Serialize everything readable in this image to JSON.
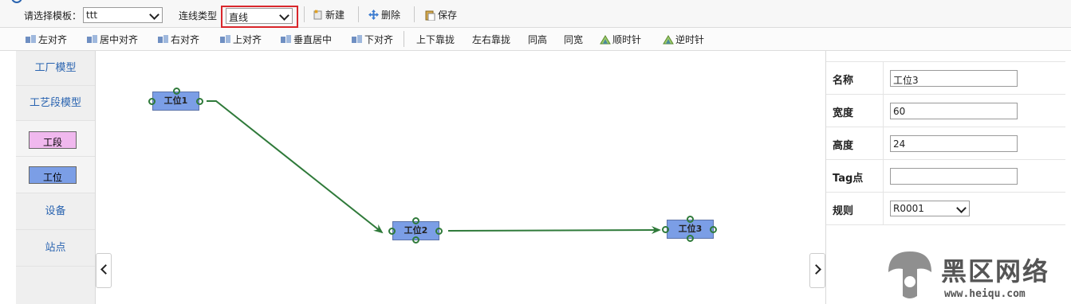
{
  "toolbar": {
    "template_label": "请选择模板：",
    "template_value": "ttt",
    "line_type_label": "连线类型",
    "line_type_value": "直线",
    "new_label": "新建",
    "delete_label": "删除",
    "save_label": "保存"
  },
  "align_toolbar": {
    "items": [
      "左对齐",
      "居中对齐",
      "右对齐",
      "上对齐",
      "垂直居中",
      "下对齐",
      "上下靠拢",
      "左右靠拢",
      "同高",
      "同宽",
      "顺时针",
      "逆时针"
    ]
  },
  "sidebar": {
    "factory_model": "工厂模型",
    "process_model": "工艺段模型",
    "segment_chip": "工段",
    "station_chip": "工位",
    "device": "设备",
    "site": "站点"
  },
  "canvas": {
    "nodes": [
      "工位1",
      "工位2",
      "工位3"
    ]
  },
  "properties": {
    "name_label": "名称",
    "name_value": "工位3",
    "width_label": "宽度",
    "width_value": "60",
    "height_label": "高度",
    "height_value": "24",
    "tag_label": "Tag点",
    "tag_value": "",
    "rule_label": "规则",
    "rule_value": "R0001"
  },
  "watermark": {
    "brand_cn": "黑区网络",
    "url": "www.heiqu.com"
  },
  "colors": {
    "link_blue": "#2a64b0",
    "node_fill": "#7b9ee6",
    "segment_fill": "#f0b8ee",
    "connector_green": "#2f7a3a",
    "highlight_red": "#d9262b"
  }
}
